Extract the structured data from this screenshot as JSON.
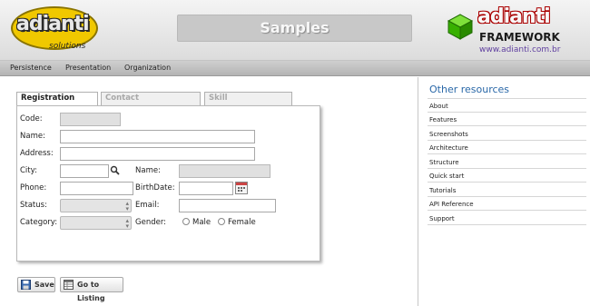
{
  "header": {
    "logo_left_word": "adianti",
    "logo_left_sub": "solutions",
    "title": "Samples",
    "logo_right_word": "adianti",
    "logo_right_framework": "FRAMEWORK",
    "logo_right_url": "www.adianti.com.br"
  },
  "menu": [
    "Persistence",
    "Presentation",
    "Organization"
  ],
  "tabs": [
    "Registration Data",
    "Contact (composition)",
    "Skill (aggregation)"
  ],
  "form": {
    "code_label": "Code:",
    "name_label": "Name:",
    "address_label": "Address:",
    "city_label": "City:",
    "city_name_label": "Name:",
    "phone_label": "Phone:",
    "birthdate_label": "BirthDate:",
    "status_label": "Status:",
    "email_label": "Email:",
    "category_label": "Category:",
    "gender_label": "Gender:",
    "gender_male": "Male",
    "gender_female": "Female",
    "code_value": "",
    "name_value": "",
    "address_value": "",
    "city_value": "",
    "city_name_value": "",
    "phone_value": "",
    "birthdate_value": "",
    "email_value": "",
    "status_value": "",
    "category_value": ""
  },
  "buttons": {
    "save": "Save",
    "go_to_listing": "Go to Listing"
  },
  "sidebar": {
    "title": "Other resources",
    "items": [
      "About",
      "Features",
      "Screenshots",
      "Architecture",
      "Structure",
      "Quick start",
      "Tutorials",
      "API Reference",
      "Support"
    ]
  },
  "colors": {
    "sidebar_title": "#2a68a8",
    "logo_left": "#f0c800",
    "logo_right_cube": "#38b000"
  },
  "icons": {
    "search": "search-icon",
    "calendar": "calendar-icon",
    "save": "floppy-disk-icon",
    "listing": "table-list-icon"
  }
}
